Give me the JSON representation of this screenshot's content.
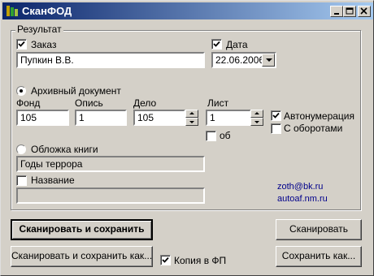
{
  "window": {
    "title": "СканФОД"
  },
  "group": {
    "title": "Результат"
  },
  "order": {
    "label": "Заказ",
    "checked": true,
    "value": "Пупкин В.В."
  },
  "date": {
    "label": "Дата",
    "checked": true,
    "value": "22.06.2006"
  },
  "archive": {
    "label": "Архивный документ",
    "selected": true
  },
  "fond": {
    "label": "Фонд",
    "value": "105"
  },
  "opis": {
    "label": "Опись",
    "value": "1"
  },
  "delo": {
    "label": "Дело",
    "value": "105"
  },
  "list": {
    "label": "Лист",
    "value": "1"
  },
  "ob": {
    "label": "об",
    "checked": false
  },
  "autonum": {
    "label": "Автонумерация",
    "checked": true
  },
  "reverse": {
    "label": "С оборотами",
    "checked": false
  },
  "cover": {
    "label": "Обложка книги",
    "selected": false,
    "value": "Годы террора"
  },
  "name": {
    "label": "Название",
    "checked": false,
    "value": ""
  },
  "links": {
    "email": "zoth@bk.ru",
    "site": "autoaf.nm.ru"
  },
  "buttons": {
    "scan_save": "Сканировать и сохранить",
    "scan": "Сканировать",
    "scan_save_as": "Сканировать и сохранить как...",
    "save_as": "Сохранить как..."
  },
  "copy_fp": {
    "label": "Копия в ФП",
    "checked": true
  }
}
